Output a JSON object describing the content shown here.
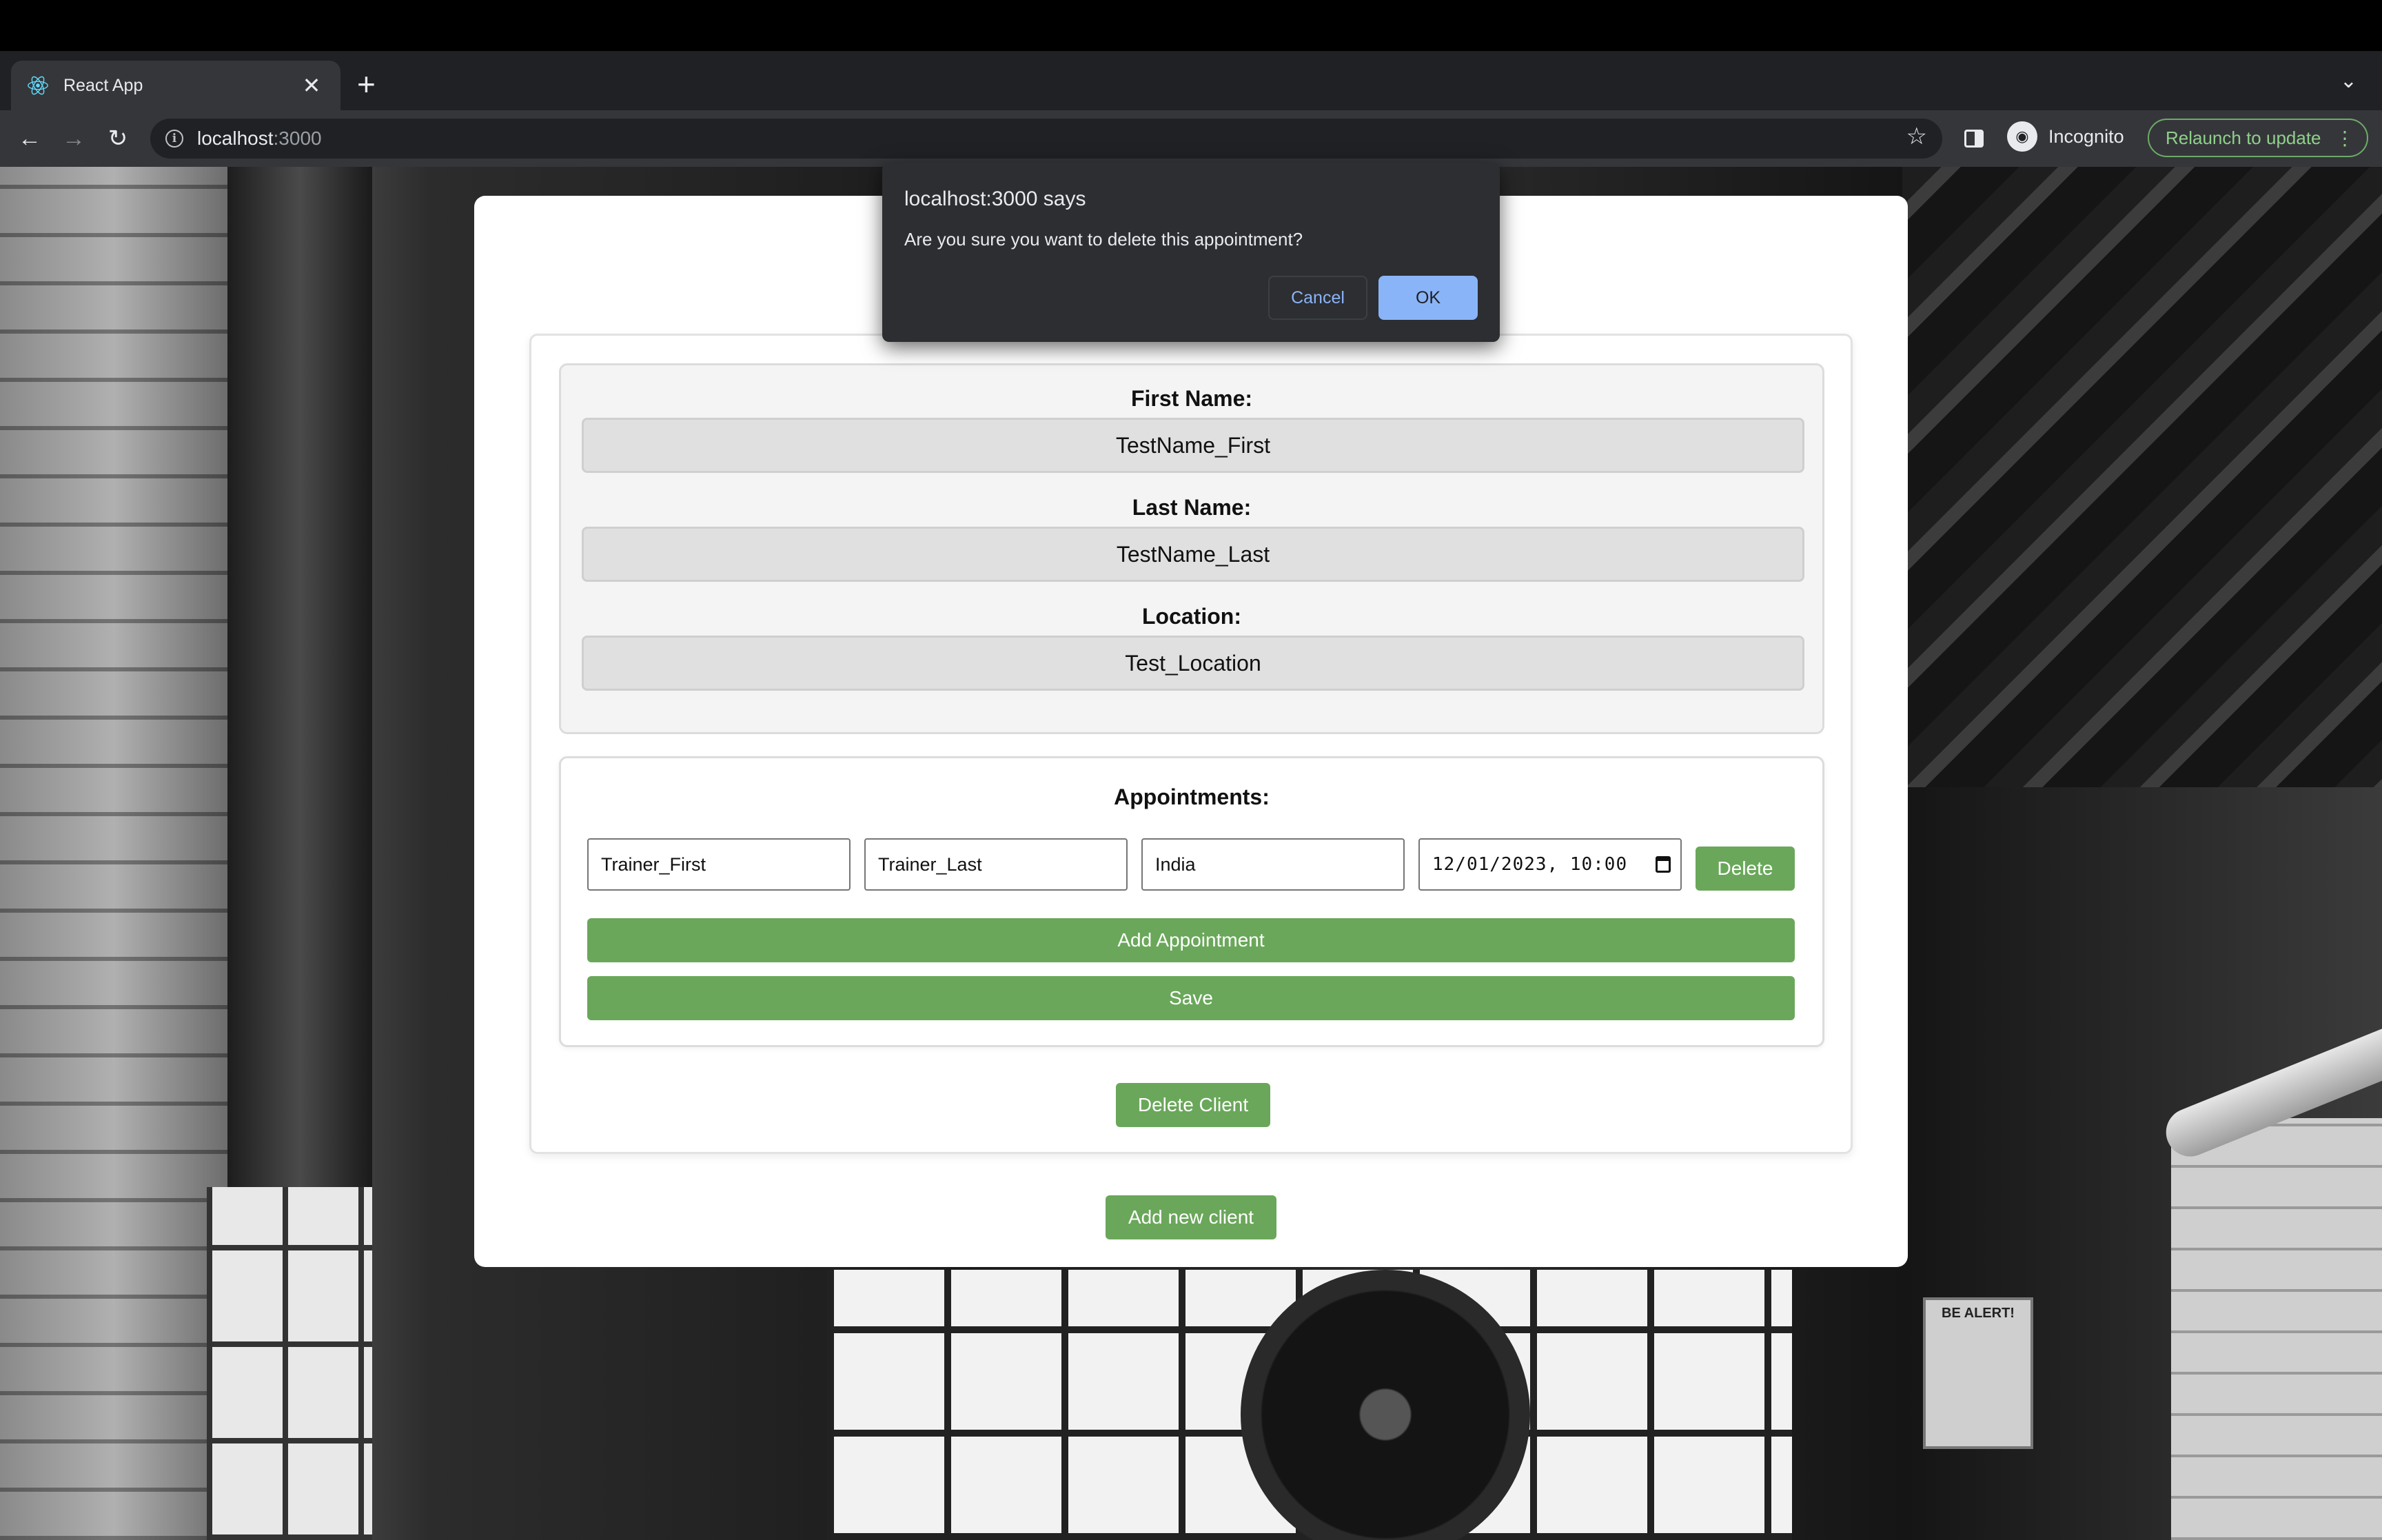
{
  "browser": {
    "tab": {
      "title": "React App",
      "favicon": "react-icon",
      "close_glyph": "✕"
    },
    "new_tab_glyph": "+",
    "tab_menu_glyph": "⌄",
    "nav": {
      "back": "←",
      "forward": "→",
      "reload": "↻"
    },
    "address": {
      "host": "localhost",
      "port": ":3000"
    },
    "star_glyph": "☆",
    "incognito_label": "Incognito",
    "relaunch_label": "Relaunch to update",
    "relaunch_dots": "⋮"
  },
  "background": {
    "sign_text": "BE ALERT!"
  },
  "client": {
    "first_name_label": "First Name:",
    "first_name_value": "TestName_First",
    "last_name_label": "Last Name:",
    "last_name_value": "TestName_Last",
    "location_label": "Location:",
    "location_value": "Test_Location"
  },
  "appointments": {
    "title": "Appointments:",
    "rows": [
      {
        "trainer_first": "Trainer_First",
        "trainer_last": "Trainer_Last",
        "location": "India",
        "datetime": "12/01/2023, 10:00",
        "delete_label": "Delete"
      }
    ],
    "add_label": "Add Appointment",
    "save_label": "Save"
  },
  "actions": {
    "delete_client_label": "Delete Client",
    "add_client_label": "Add new client"
  },
  "dialog": {
    "title": "localhost:3000 says",
    "message": "Are you sure you want to delete this appointment?",
    "cancel_label": "Cancel",
    "ok_label": "OK"
  },
  "colors": {
    "accent_green": "#6aa75a",
    "dialog_bg": "#2d2e31",
    "dialog_ok": "#8ab4f8",
    "chrome_dark": "#202124"
  }
}
